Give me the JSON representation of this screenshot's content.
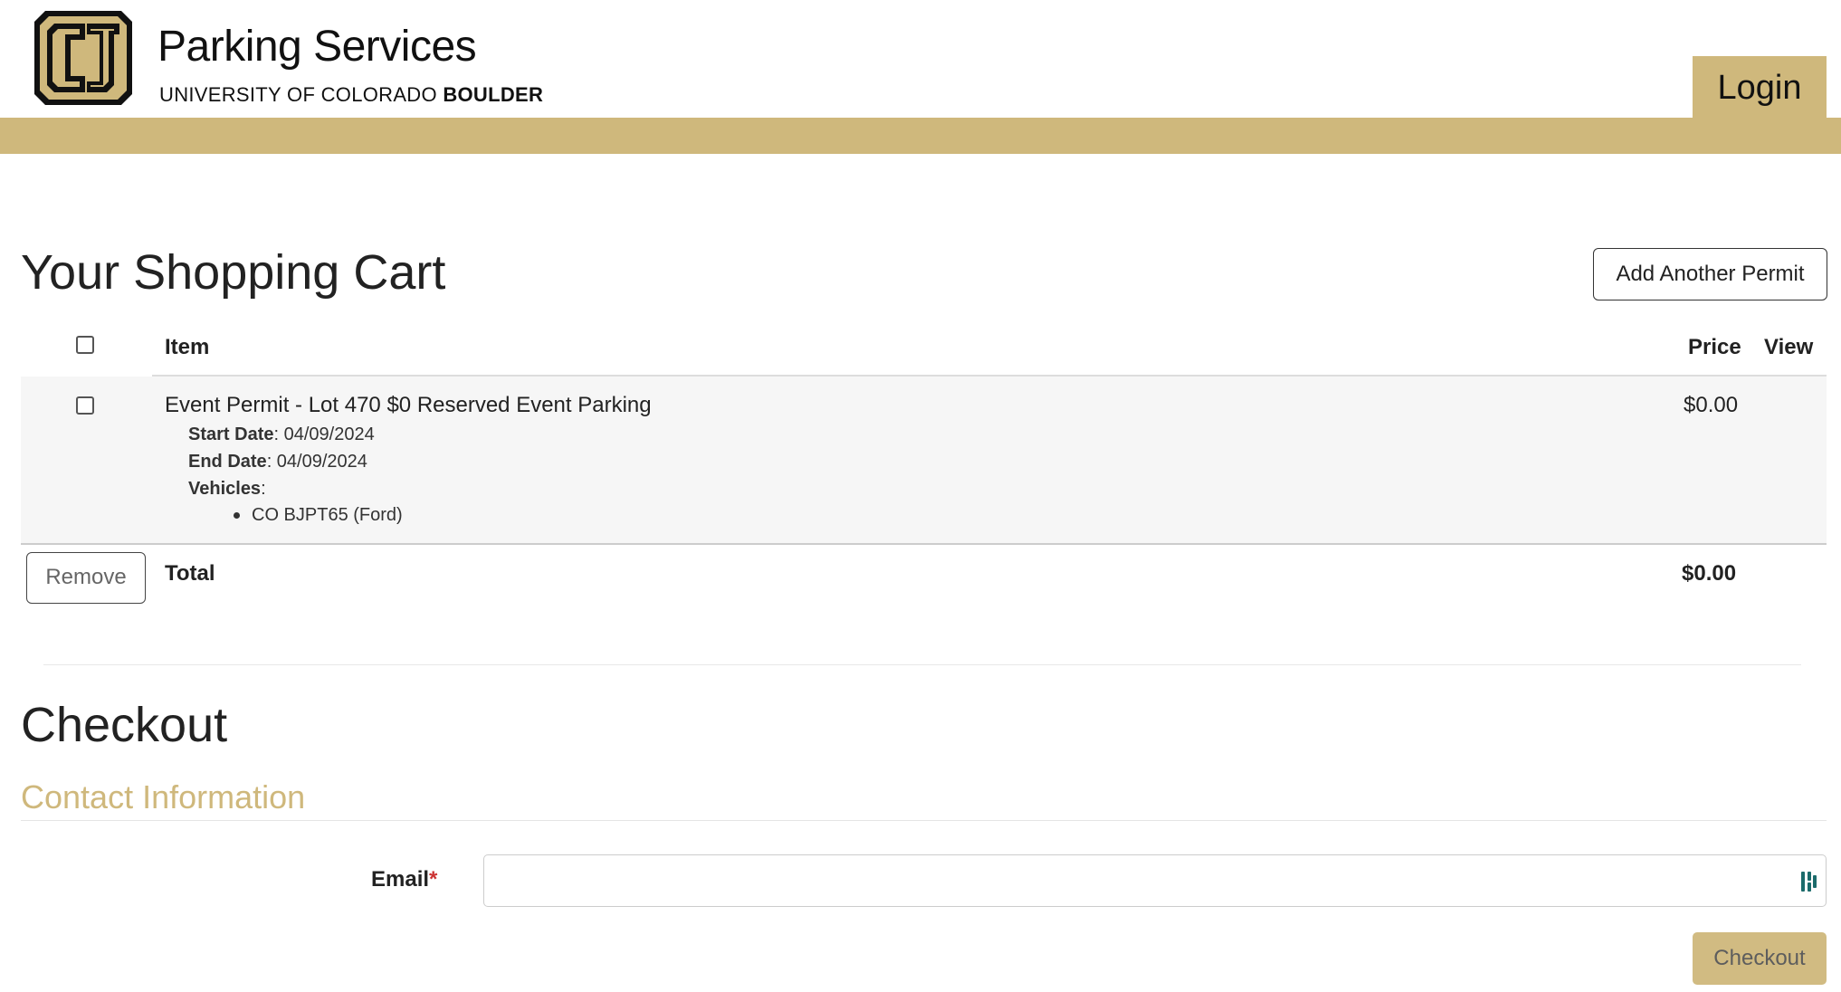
{
  "header": {
    "title": "Parking Services",
    "subtitle_prefix": "UNIVERSITY OF COLORADO ",
    "subtitle_bold": "BOULDER",
    "login_label": "Login",
    "brand_gold": "#CFB87C"
  },
  "cart": {
    "title": "Your Shopping Cart",
    "add_permit_label": "Add Another Permit",
    "columns": {
      "item": "Item",
      "price": "Price",
      "view": "View"
    },
    "items": [
      {
        "name": "Event Permit - Lot 470 $0 Reserved Event Parking",
        "start_label": "Start Date",
        "start_value": ": 04/09/2024",
        "end_label": "End Date",
        "end_value": ": 04/09/2024",
        "vehicles_label": "Vehicles",
        "vehicles_suffix": ":",
        "vehicles": [
          "CO BJPT65 (Ford)"
        ],
        "price": "$0.00"
      }
    ],
    "remove_label": "Remove",
    "total_label": "Total",
    "total_value": "$0.00"
  },
  "checkout": {
    "title": "Checkout",
    "section_title": "Contact Information",
    "email_label": "Email",
    "required_mark": "*",
    "email_value": "",
    "submit_label": "Checkout"
  }
}
